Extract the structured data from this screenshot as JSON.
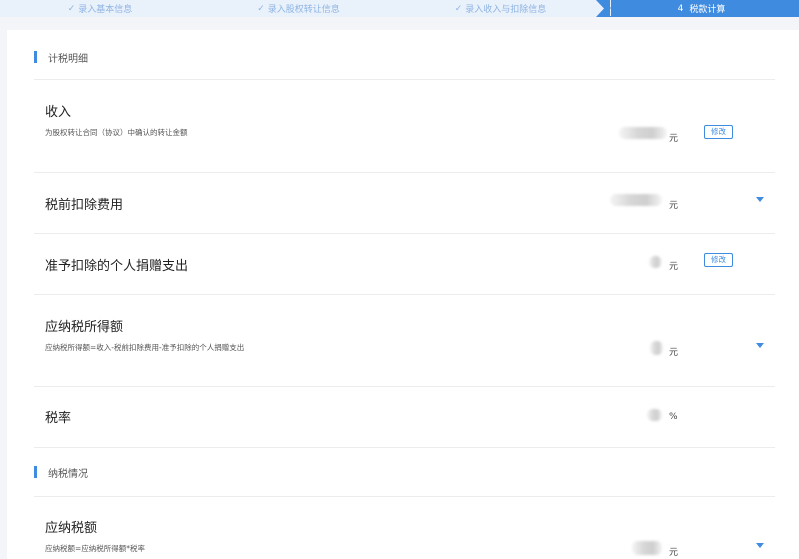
{
  "steps": [
    {
      "label": "录入基本信息",
      "state": "done"
    },
    {
      "label": "录入股权转让信息",
      "state": "done"
    },
    {
      "label": "录入收入与扣除信息",
      "state": "done"
    },
    {
      "number": "4",
      "label": "税款计算",
      "state": "active"
    }
  ],
  "sections": {
    "tax_detail": "计税明细",
    "payment": "纳税情况"
  },
  "rows": {
    "income": {
      "title": "收入",
      "subtitle": "为股权转让合同（协议）中确认的转让金额",
      "unit": "元",
      "action": "修改"
    },
    "pretax_deduction": {
      "title": "税前扣除费用",
      "unit": "元"
    },
    "donation": {
      "title": "准予扣除的个人捐赠支出",
      "unit": "元",
      "action": "修改"
    },
    "taxable_income": {
      "title": "应纳税所得额",
      "subtitle": "应纳税所得额=收入-税前扣除费用-准予扣除的个人捐赠支出",
      "unit": "元"
    },
    "tax_rate": {
      "title": "税率",
      "unit": "%"
    },
    "tax_payable": {
      "title": "应纳税额",
      "subtitle": "应纳税额=应纳税所得额*税率",
      "unit": "元"
    }
  },
  "colors": {
    "accent": "#3e8be0",
    "step_bg": "#e9f1fb"
  },
  "icons": {
    "check": "check-icon",
    "expand": "caret-down-icon"
  }
}
